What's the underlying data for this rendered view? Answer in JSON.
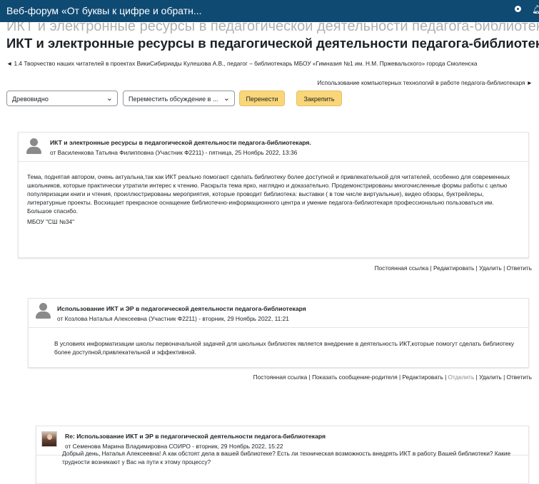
{
  "topbar": {
    "site_title": "Веб-форум «От буквы к цифре и обратн..."
  },
  "page": {
    "ghost_title": "ИКТ и электронные ресурсы в педагогической деятельности педагога-библиотекаря.",
    "heading": "ИКТ и электронные ресурсы в педагогической деятельности педагога-библиотекаря.",
    "prev_discussion": "◄ 1.4 Творчество наших читателей в проектах ВикиСибириады Кулешова А.В., педагог – библиотекарь МБОУ «Гимназия №1 им. Н.М. Пржевальского» города Смоленска",
    "next_discussion": "Использование компьютерных технологий в работе педагога-библиотекаря ►"
  },
  "controls": {
    "display_mode": "Древовидно",
    "move_discussion": "Переместить обсуждение в ...",
    "move_button": "Перенести",
    "pin_button": "Закрепить"
  },
  "posts": [
    {
      "subject": "ИКТ и электронные ресурсы в педагогической деятельности педагога-библиотекаря.",
      "byline": "от Василенкова Татьяна Филипповна (Участник Ф2211) - пятница, 25 Ноябрь 2022, 13:36",
      "paragraphs": [
        "Тема, поднятая автором, очень актуальна,так как ИКТ реально помогают сделать библиотеку более доступной и привлекательной для читателей, особенно для современных школьников, которые практически утратили интерес к чтению. Раскрыта тема ярко, наглядно и доказательно. Продемонстрированы многочисленные формы работы с целью популяризации книги и чтения, проиллюстрированы мероприятия, которые проводит библиотека: выставки ( в том числе виртуальные), видео обзоры, буктрейлеры, литературные проекты. Восхищает прекрасное оснащение библиотечно-информационного центра и умение педагога-библиотекаря профессионально пользоваться им. Большое спасибо.",
        "МБОУ \"СШ №34\""
      ],
      "commands": {
        "permalink": "Постоянная ссылка",
        "edit": "Редактировать",
        "delete": "Удалить",
        "reply": "Ответить"
      }
    },
    {
      "subject": "Использование ИКТ и ЭР в педагогической деятельности педагога-библиотекаря",
      "byline": "от Козлова Наталья Алексеевна (Участник Ф2211) - вторник, 29 Ноябрь 2022, 11:21",
      "paragraphs": [
        "В условиях информатизации школы первоначальной задачей для школьных библиотек является внедрение в деятельность ИКТ,которые помогут сделать библиотеку более доступной,привлекательной и эффективной."
      ],
      "commands": {
        "permalink": "Постоянная ссылка",
        "parent": "Показать сообщение-родителя",
        "edit": "Редактировать",
        "split": "Отделить",
        "delete": "Удалить",
        "reply": "Ответить"
      }
    },
    {
      "subject": "Re: Использование ИКТ и ЭР в педагогической деятельности педагога-библиотекаря",
      "byline": "от Семенова Марина Владимировна СОИРО - вторник, 29 Ноябрь 2022, 15:22",
      "paragraphs": [
        "Добрый день, Наталья Алексеевна! А как обстоят дела в вашей библиотеке? Есть ли техническая возможность внедрять ИКТ в работу Вашей библиотеки? Какие трудности возникают у Вас на пути к этому процессу?"
      ]
    }
  ]
}
